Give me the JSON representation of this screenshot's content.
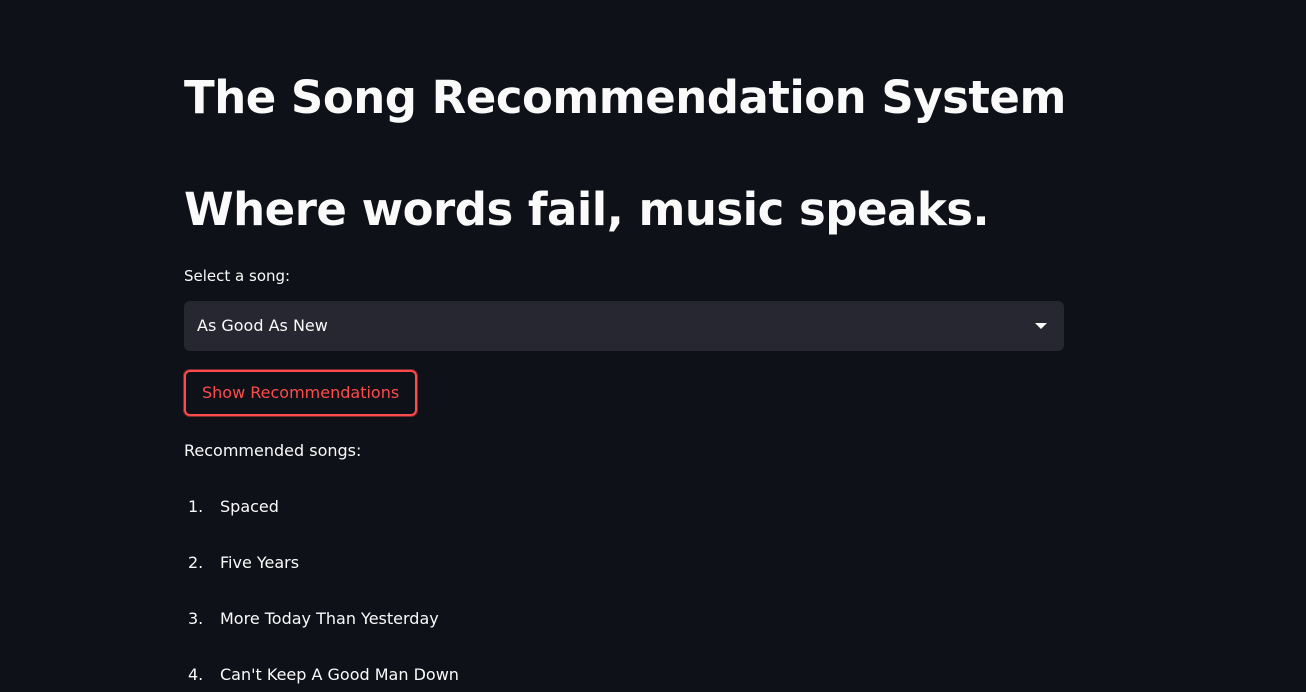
{
  "header": {
    "title": "The Song Recommendation System",
    "subtitle": "Where words fail, music speaks."
  },
  "song_select": {
    "label": "Select a song:",
    "selected_value": "As Good As New",
    "icon": "chevron-down-icon"
  },
  "actions": {
    "show_recommendations_label": "Show Recommendations"
  },
  "recommendations": {
    "label": "Recommended songs:",
    "items": [
      {
        "number": "1.",
        "title": "Spaced"
      },
      {
        "number": "2.",
        "title": "Five Years"
      },
      {
        "number": "3.",
        "title": "More Today Than Yesterday"
      },
      {
        "number": "4.",
        "title": "Can't Keep A Good Man Down"
      }
    ]
  },
  "colors": {
    "background": "#0e1117",
    "text": "#fafafa",
    "input_background": "#262730",
    "accent": "#ff4b4b"
  }
}
